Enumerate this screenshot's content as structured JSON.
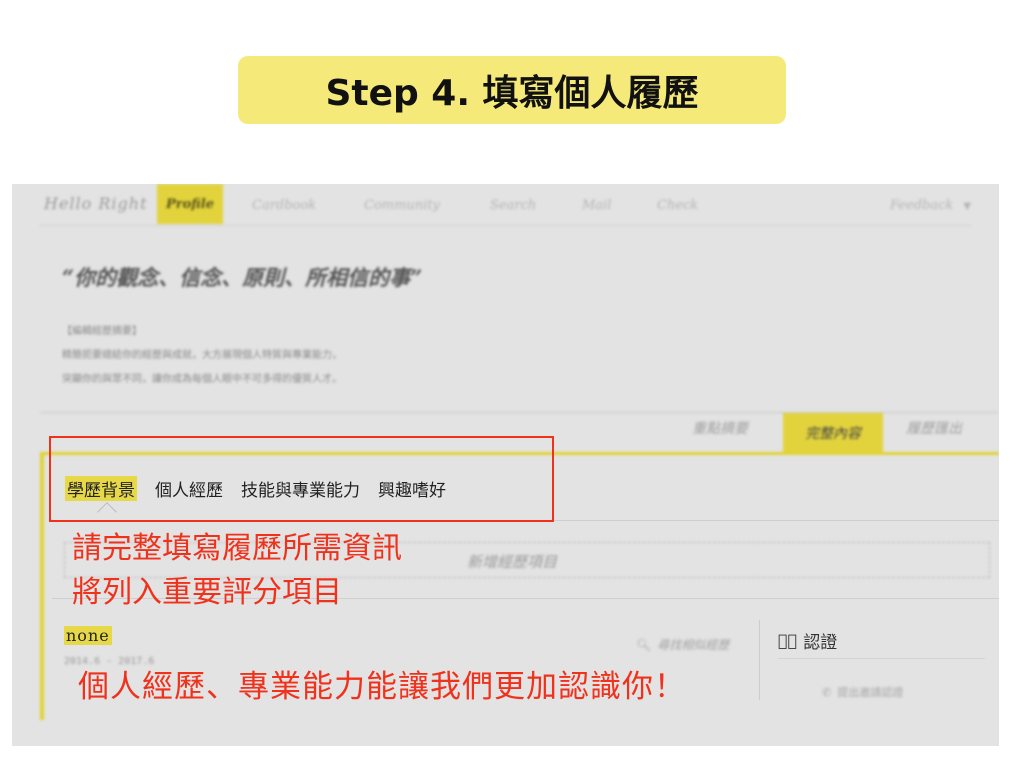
{
  "step_title": "Step 4. 填寫個人履歷",
  "nav": {
    "logo": "Hello Right",
    "tabs": [
      "Profile",
      "Cardbook",
      "Community",
      "Search",
      "Mail",
      "Check"
    ],
    "feedback": "Feedback"
  },
  "profile": {
    "quote": "“你的觀念、信念、原則、所相信的事”",
    "desc_lines": [
      "【編輯經歷摘要】",
      "精簡扼要總結你的經歷與成就，大方展現個人特質與專業能力，",
      "突顯你的與眾不同，讓你成為每個人眼中不可多得的優質人才。"
    ]
  },
  "view_tabs": [
    "重點摘要",
    "完整內容",
    "履歷匯出"
  ],
  "section_tabs": [
    "學歷背景",
    "個人經歷",
    "技能與專業能力",
    "興趣嗜好"
  ],
  "add_item": "新增經歷項目",
  "experience": {
    "title": "none",
    "date": "2014.6 - 2017.6",
    "find_similar": "尋找相似經歷"
  },
  "certification": {
    "label": "認證",
    "link": "提出邀請認證"
  },
  "annotations": {
    "line1": "請完整填寫履歷所需資訊",
    "line2": "將列入重要評分項目",
    "line3": "個人經歷、專業能力能讓我們更加認識你！"
  },
  "colors": {
    "accent_yellow": "#e2d33c",
    "title_yellow": "#f5e97a",
    "annotation_red": "#f0321c"
  }
}
